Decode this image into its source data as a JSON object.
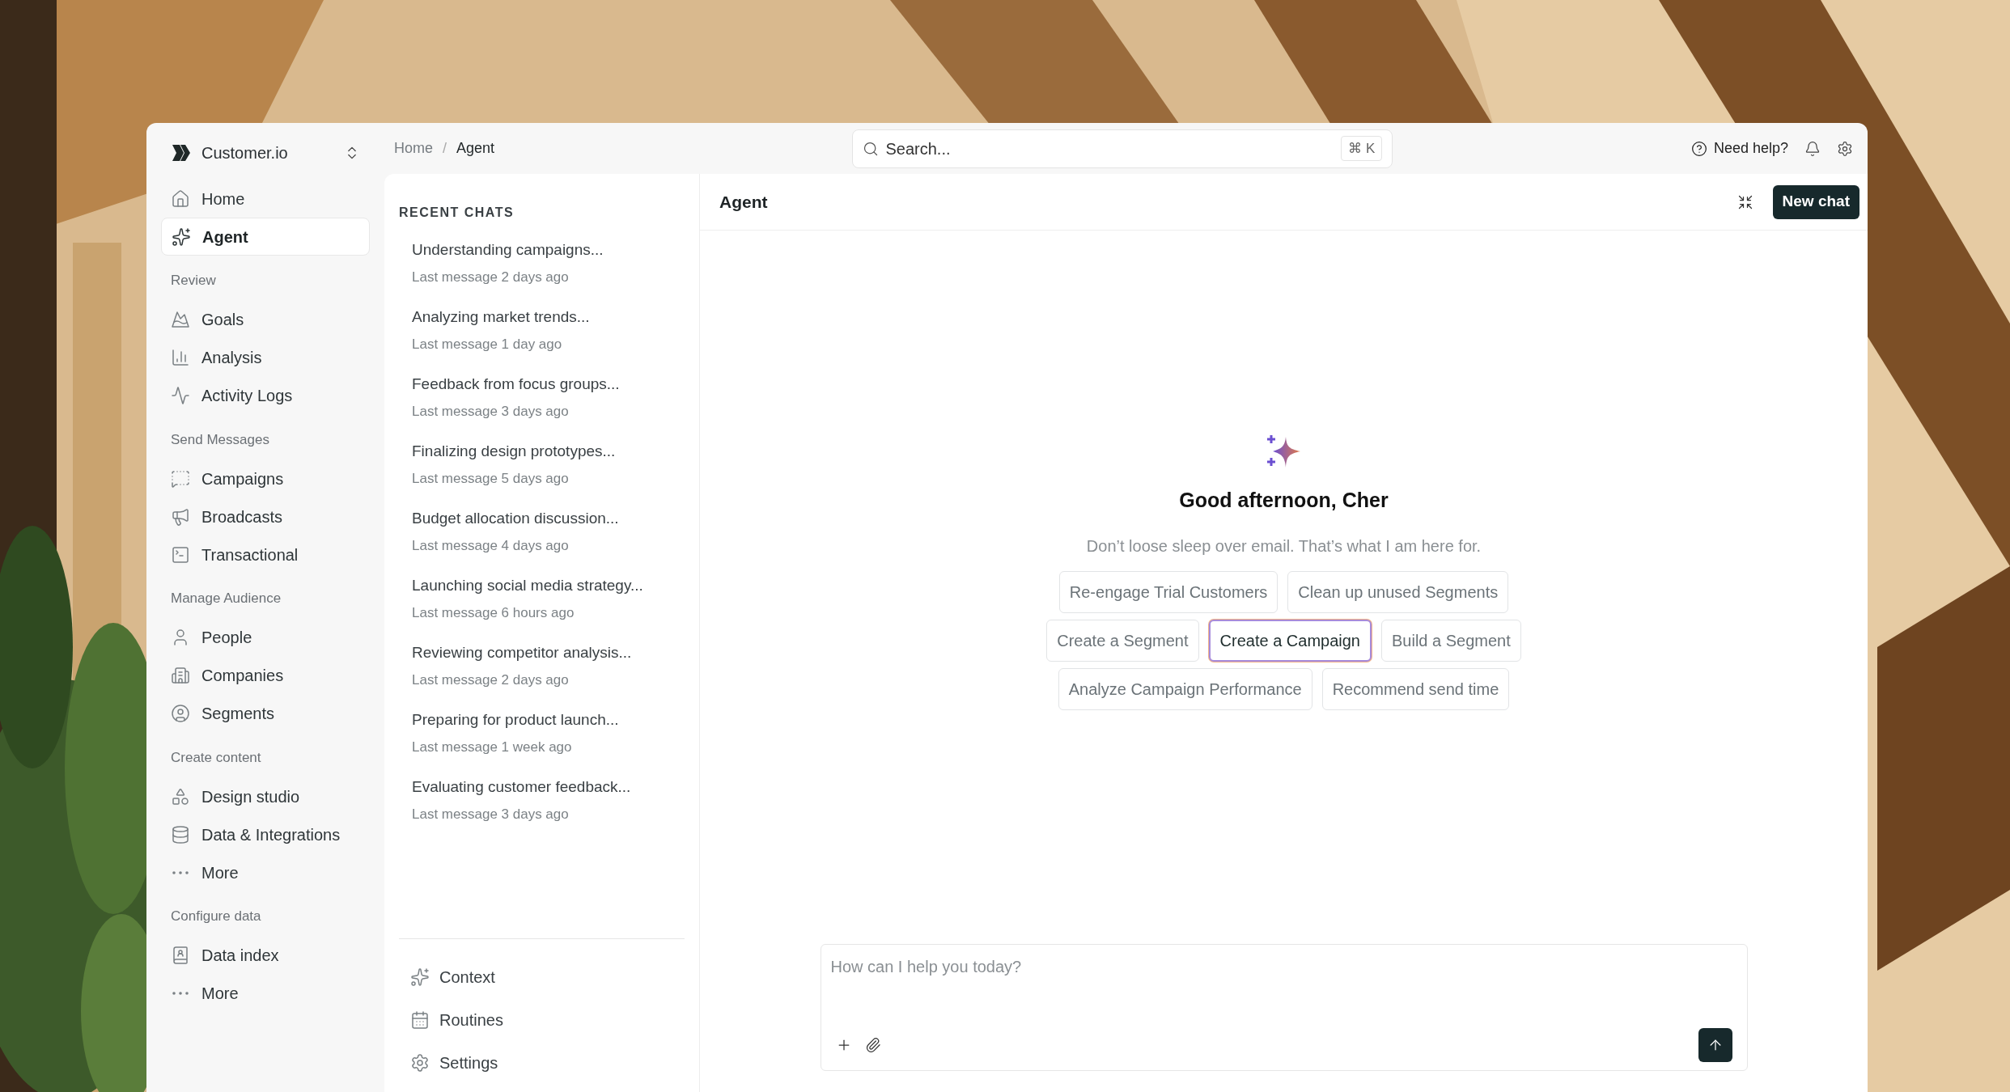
{
  "workspace": {
    "name": "Customer.io"
  },
  "sidebar": {
    "items": [
      {
        "kind": "item",
        "label": "Home",
        "selected": false
      },
      {
        "kind": "item",
        "label": "Agent",
        "selected": true
      },
      {
        "kind": "heading",
        "label": "Review"
      },
      {
        "kind": "item",
        "label": "Goals",
        "selected": false
      },
      {
        "kind": "item",
        "label": "Analysis",
        "selected": false
      },
      {
        "kind": "item",
        "label": "Activity Logs",
        "selected": false
      },
      {
        "kind": "heading",
        "label": "Send Messages"
      },
      {
        "kind": "item",
        "label": "Campaigns",
        "selected": false
      },
      {
        "kind": "item",
        "label": "Broadcasts",
        "selected": false
      },
      {
        "kind": "item",
        "label": "Transactional",
        "selected": false
      },
      {
        "kind": "heading",
        "label": "Manage Audience"
      },
      {
        "kind": "item",
        "label": "People",
        "selected": false
      },
      {
        "kind": "item",
        "label": "Companies",
        "selected": false
      },
      {
        "kind": "item",
        "label": "Segments",
        "selected": false
      },
      {
        "kind": "heading",
        "label": "Create content"
      },
      {
        "kind": "item",
        "label": "Design studio",
        "selected": false
      },
      {
        "kind": "item",
        "label": "Data & Integrations",
        "selected": false
      },
      {
        "kind": "item",
        "label": "More",
        "selected": false
      },
      {
        "kind": "heading",
        "label": "Configure data"
      },
      {
        "kind": "item",
        "label": "Data index",
        "selected": false
      },
      {
        "kind": "item",
        "label": "More",
        "selected": false
      }
    ]
  },
  "breadcrumb": {
    "separator": "/",
    "items": [
      {
        "label": "Home",
        "current": false
      },
      {
        "label": "Agent",
        "current": true
      }
    ]
  },
  "search": {
    "placeholder": "Search...",
    "shortcut": "⌘ K"
  },
  "header_actions": {
    "help": "Need help?"
  },
  "recent_chats": {
    "heading": "RECENT CHATS",
    "items": [
      {
        "title": "Understanding campaigns...",
        "meta": "Last message 2 days ago"
      },
      {
        "title": "Analyzing market trends...",
        "meta": "Last message 1 day ago"
      },
      {
        "title": "Feedback from focus groups...",
        "meta": "Last message 3 days ago"
      },
      {
        "title": "Finalizing design prototypes...",
        "meta": "Last message 5 days ago"
      },
      {
        "title": "Budget allocation discussion...",
        "meta": "Last message 4 days ago"
      },
      {
        "title": "Launching social media strategy...",
        "meta": "Last message 6 hours ago"
      },
      {
        "title": "Reviewing competitor analysis...",
        "meta": "Last message 2 days ago"
      },
      {
        "title": "Preparing for product launch...",
        "meta": "Last message 1 week ago"
      },
      {
        "title": "Evaluating customer feedback...",
        "meta": "Last message 3 days ago"
      }
    ],
    "footer": [
      {
        "label": "Context"
      },
      {
        "label": "Routines"
      },
      {
        "label": "Settings"
      }
    ]
  },
  "main": {
    "title": "Agent",
    "new_chat": "New chat",
    "greeting": "Good afternoon, Cher",
    "subtitle": "Don’t loose sleep over email. That’s what I am here for.",
    "suggestion_rows": [
      [
        {
          "label": "Re-engage Trial Customers",
          "selected": false
        },
        {
          "label": "Clean up unused Segments",
          "selected": false
        }
      ],
      [
        {
          "label": "Create a Segment",
          "selected": false
        },
        {
          "label": "Create a Campaign",
          "selected": true
        },
        {
          "label": "Build a Segment",
          "selected": false
        }
      ],
      [
        {
          "label": "Analyze Campaign Performance",
          "selected": false
        },
        {
          "label": "Recommend send time",
          "selected": false
        }
      ]
    ],
    "composer": {
      "placeholder": "How can I help you today?"
    }
  }
}
